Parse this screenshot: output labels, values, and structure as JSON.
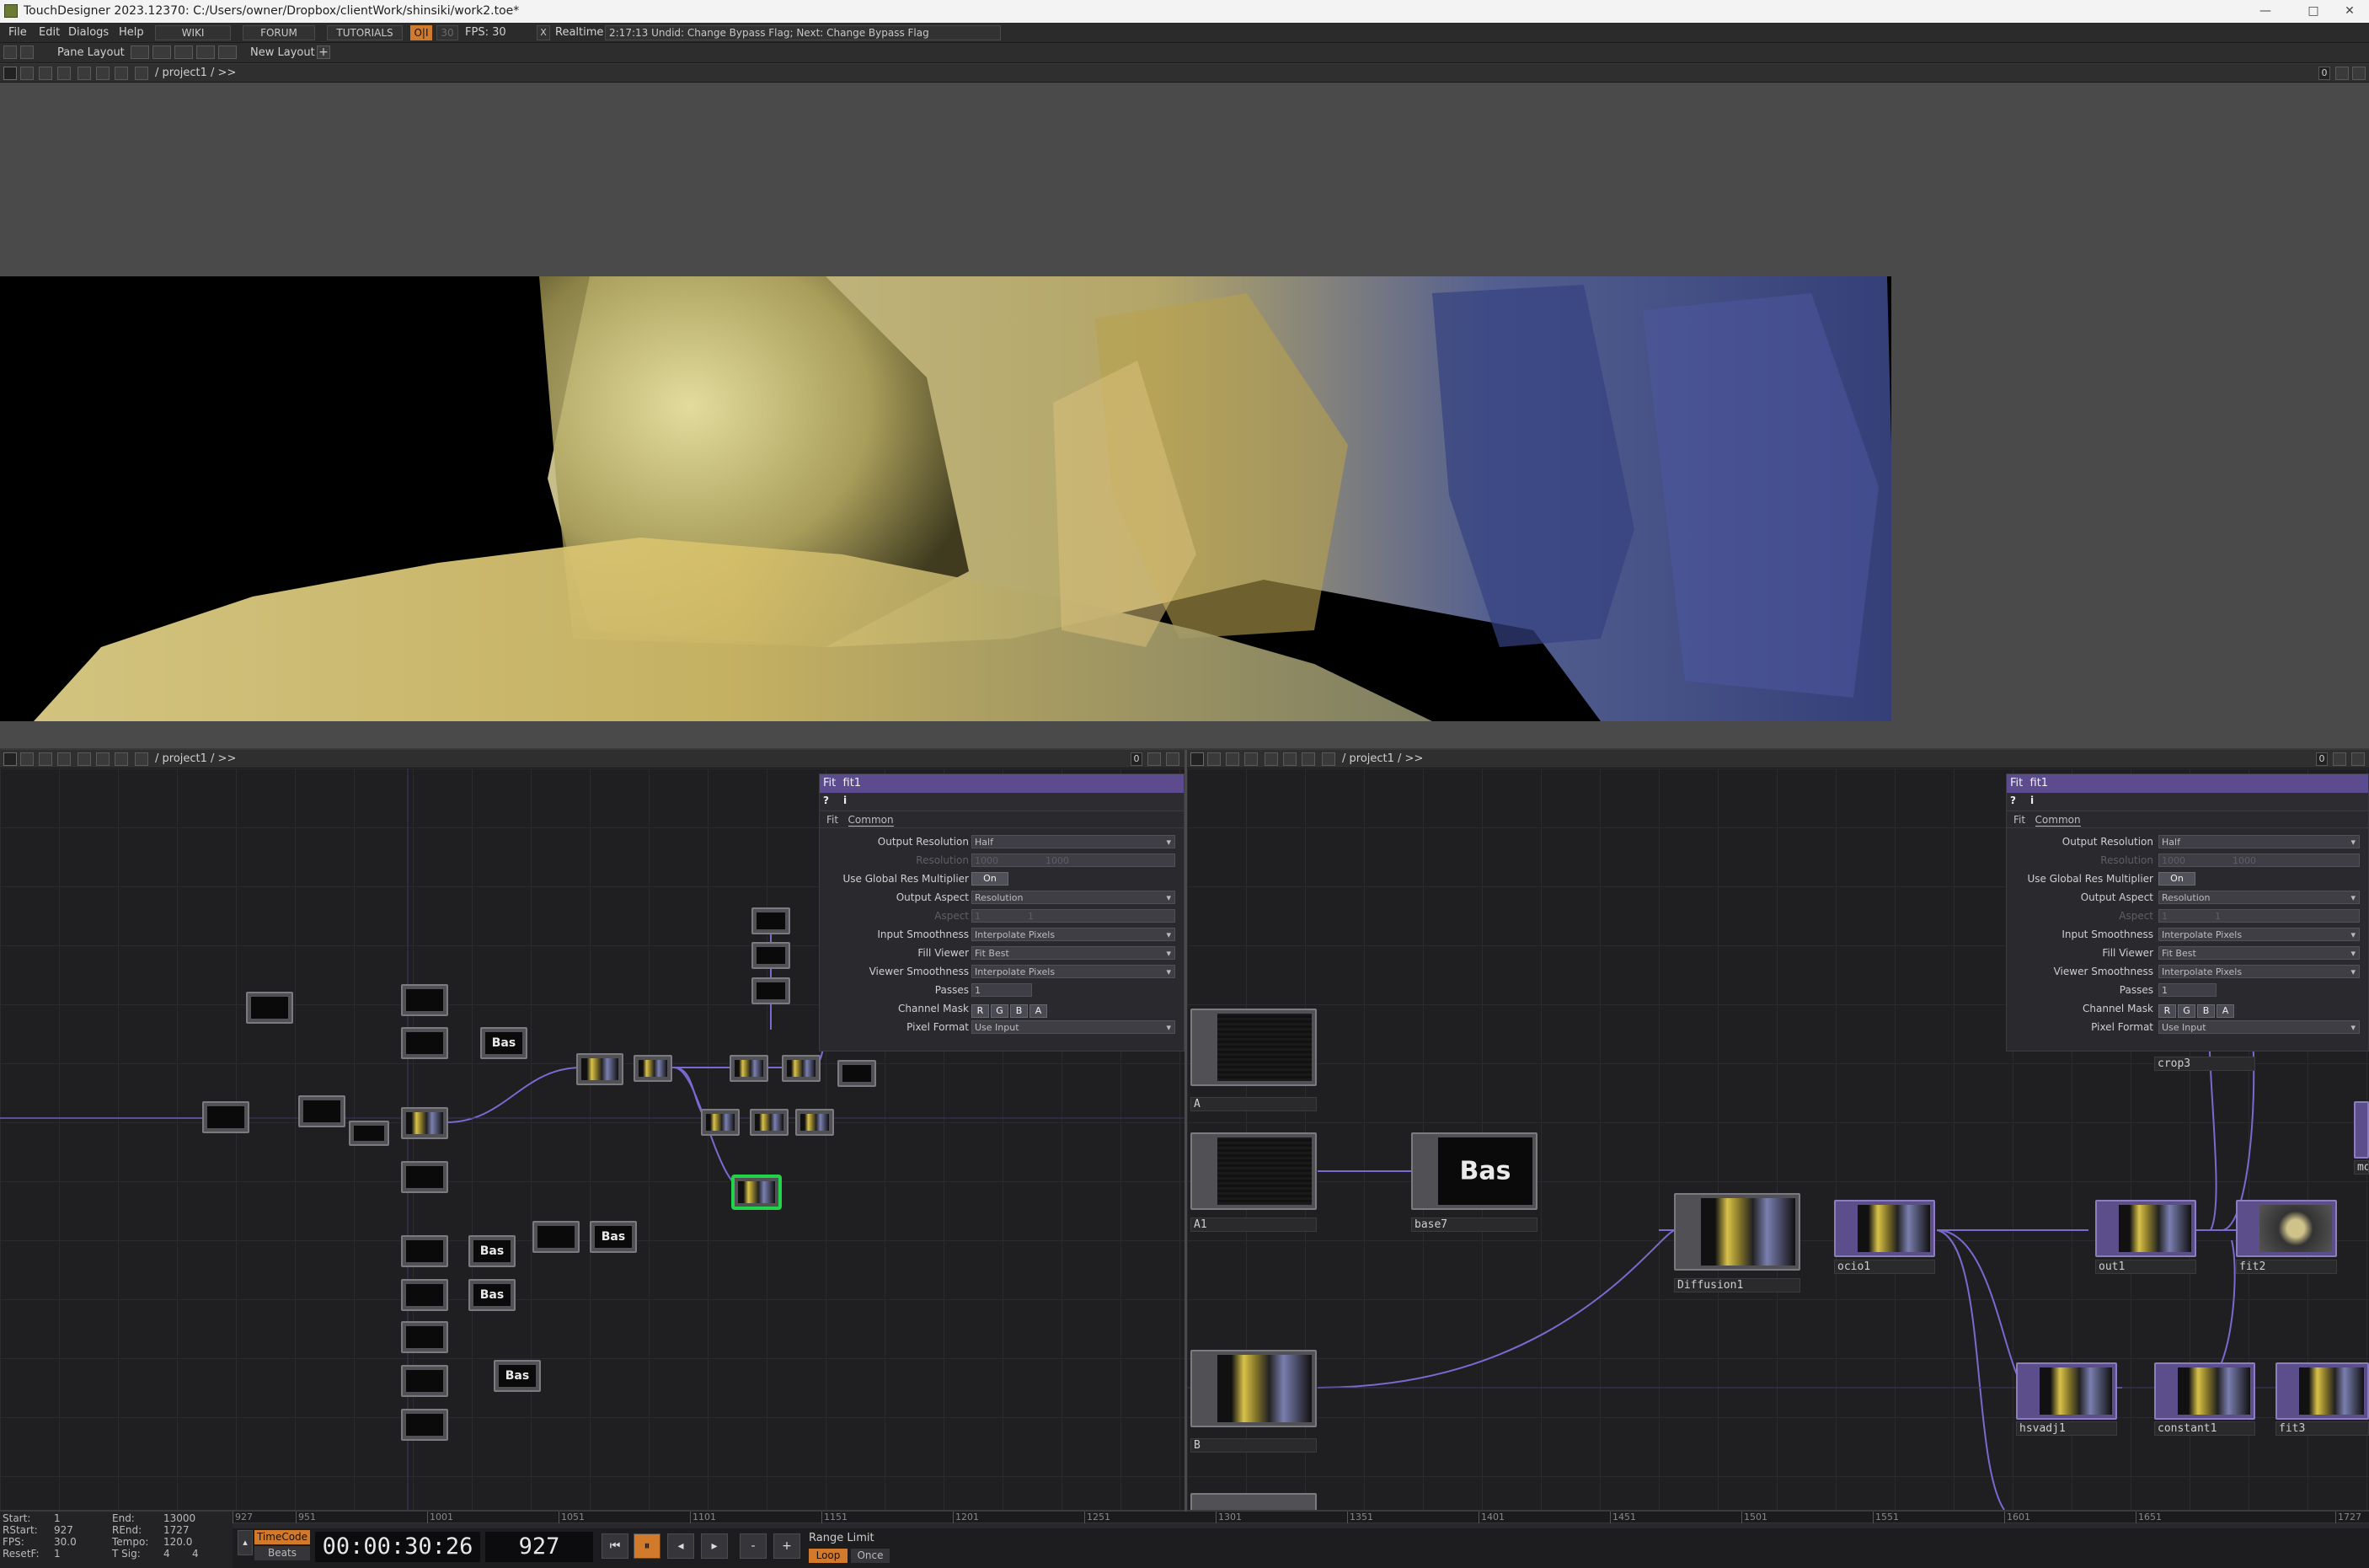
{
  "window": {
    "title": "TouchDesigner 2023.12370: C:/Users/owner/Dropbox/clientWork/shinsiki/work2.toe*",
    "minimize": "—",
    "maximize": "□",
    "close": "✕"
  },
  "menu": {
    "items": [
      "File",
      "Edit",
      "Dialogs",
      "Help"
    ],
    "wiki": "WIKI",
    "forum": "FORUM",
    "tutorials": "TUTORIALS",
    "oi": "O|I",
    "fps_num": "30",
    "fps": "FPS:  30",
    "realtime": "Realtime",
    "realtime_check": "X",
    "status": "2:17:13 Undid: Change Bypass Flag; Next: Change Bypass Flag"
  },
  "layoutbar": {
    "pane_layout": "Pane Layout",
    "new_layout": "New Layout",
    "plus": "+"
  },
  "top_path": {
    "path": "/ project1 / >>",
    "counter": "0"
  },
  "left_pane": {
    "path": "/ project1 / >>",
    "counter": "0"
  },
  "right_pane": {
    "path": "/ project1 / >>",
    "counter": "0"
  },
  "param": {
    "type": "Fit",
    "name": "fit1",
    "help": "?",
    "info": "i",
    "tabs": [
      "Fit",
      "Common"
    ],
    "rows": {
      "output_resolution": {
        "label": "Output Resolution",
        "value": "Half"
      },
      "resolution": {
        "label": "Resolution",
        "v1": "1000",
        "v2": "1000"
      },
      "global_res": {
        "label": "Use Global Res Multiplier",
        "value": "On"
      },
      "output_aspect": {
        "label": "Output Aspect",
        "value": "Resolution"
      },
      "aspect": {
        "label": "Aspect",
        "v1": "1",
        "v2": "1"
      },
      "input_smoothness": {
        "label": "Input Smoothness",
        "value": "Interpolate Pixels"
      },
      "fill_viewer": {
        "label": "Fill Viewer",
        "value": "Fit Best"
      },
      "viewer_smoothness": {
        "label": "Viewer Smoothness",
        "value": "Interpolate Pixels"
      },
      "passes": {
        "label": "Passes",
        "value": "1"
      },
      "channel_mask": {
        "label": "Channel Mask",
        "r": "R",
        "g": "G",
        "b": "B",
        "a": "A"
      },
      "pixel_format": {
        "label": "Pixel Format",
        "value": "Use Input"
      }
    }
  },
  "nodes": {
    "bas": "Bas",
    "a": "A",
    "a1": "A1",
    "base7": "base7",
    "diffusion1": "Diffusion1",
    "ocio1": "ocio1",
    "out1": "out1",
    "fit2": "fit2",
    "crop3": "crop3",
    "hsvadj1": "hsvadj1",
    "constant1": "constant1",
    "fit3": "fit3",
    "b": "B",
    "mo": "mo"
  },
  "timeline": {
    "start_l": "Start:",
    "start": "1",
    "end_l": "End:",
    "end": "13000",
    "rstart_l": "RStart:",
    "rstart": "927",
    "rend_l": "REnd:",
    "rend": "1727",
    "fps_l": "FPS:",
    "fps": "30.0",
    "tempo_l": "Tempo:",
    "tempo": "120.0",
    "resetf_l": "ResetF:",
    "resetf": "1",
    "tsig_l": "T Sig:",
    "tsig1": "4",
    "tsig2": "4",
    "timecode_btn": "TimeCode",
    "beats_btn": "Beats",
    "timecode": "00:00:30:26",
    "frame": "927",
    "range_limit": "Range Limit",
    "loop": "Loop",
    "once": "Once",
    "ticks": [
      "927",
      "951",
      "1001",
      "1051",
      "1101",
      "1151",
      "1201",
      "1251",
      "1301",
      "1351",
      "1401",
      "1451",
      "1501",
      "1551",
      "1601",
      "1651",
      "1727"
    ],
    "fill": 0.0
  }
}
